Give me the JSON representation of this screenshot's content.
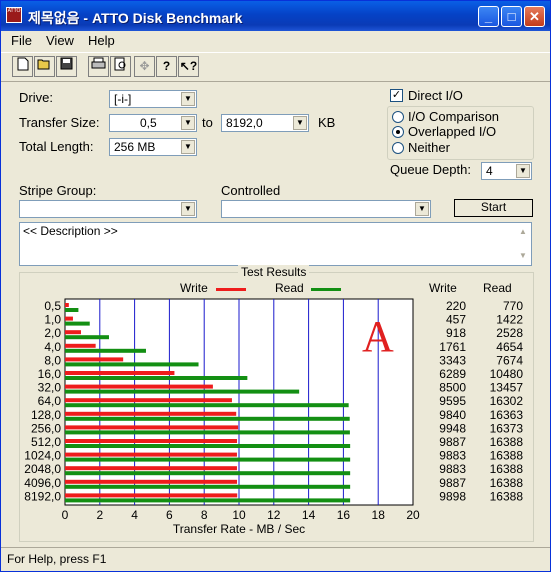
{
  "window": {
    "title": "제목없음 - ATTO Disk Benchmark",
    "icon_text": "ATTO"
  },
  "menu": {
    "items": [
      "File",
      "View",
      "Help"
    ]
  },
  "toolbar": {
    "icons": [
      "new-file-icon",
      "open-folder-icon",
      "save-icon",
      "print-icon",
      "print-preview-icon",
      "move-icon",
      "help-icon",
      "context-help-icon"
    ]
  },
  "form": {
    "drive_label": "Drive:",
    "drive_value": "[-i-]",
    "transfer_label": "Transfer Size:",
    "transfer_from": "0,5",
    "transfer_to_word": "to",
    "transfer_to": "8192,0",
    "transfer_unit": "KB",
    "length_label": "Total Length:",
    "length_value": "256 MB",
    "direct_io": "Direct I/O",
    "direct_io_checked": true,
    "io_comparison": "I/O Comparison",
    "overlapped": "Overlapped I/O",
    "neither": "Neither",
    "queue_label": "Queue Depth:",
    "queue_value": "4",
    "stripe_label": "Stripe Group:",
    "stripe_value": "",
    "controlled_label": "Controlled",
    "controlled_value": "",
    "start_label": "Start",
    "description": "<< Description >>"
  },
  "results": {
    "title": "Test Results",
    "write_label": "Write",
    "read_label": "Read",
    "col_write": "Write",
    "col_read": "Read",
    "write_color": "#ee1c1c",
    "read_color": "#138f13",
    "marker": "A",
    "marker_color": "#e02020",
    "xlabel": "Transfer Rate - MB / Sec"
  },
  "chart_data": {
    "type": "bar",
    "orientation": "horizontal",
    "categories": [
      "0,5",
      "1,0",
      "2,0",
      "4,0",
      "8,0",
      "16,0",
      "32,0",
      "64,0",
      "128,0",
      "256,0",
      "512,0",
      "1024,0",
      "2048,0",
      "4096,0",
      "8192,0"
    ],
    "series": [
      {
        "name": "Write",
        "values": [
          220,
          457,
          918,
          1761,
          3343,
          6289,
          8500,
          9595,
          9840,
          9948,
          9887,
          9883,
          9883,
          9887,
          9898
        ]
      },
      {
        "name": "Read",
        "values": [
          770,
          1422,
          2528,
          4654,
          7674,
          10480,
          13457,
          16302,
          16363,
          16373,
          16388,
          16388,
          16388,
          16388,
          16388
        ]
      }
    ],
    "xlabel": "Transfer Rate - MB / Sec",
    "xticks": [
      "0",
      "2",
      "4",
      "6",
      "8",
      "10",
      "12",
      "14",
      "16",
      "18",
      "20"
    ],
    "xlim": [
      0,
      20
    ],
    "legend": "top"
  },
  "status": {
    "text": "For Help, press F1"
  }
}
